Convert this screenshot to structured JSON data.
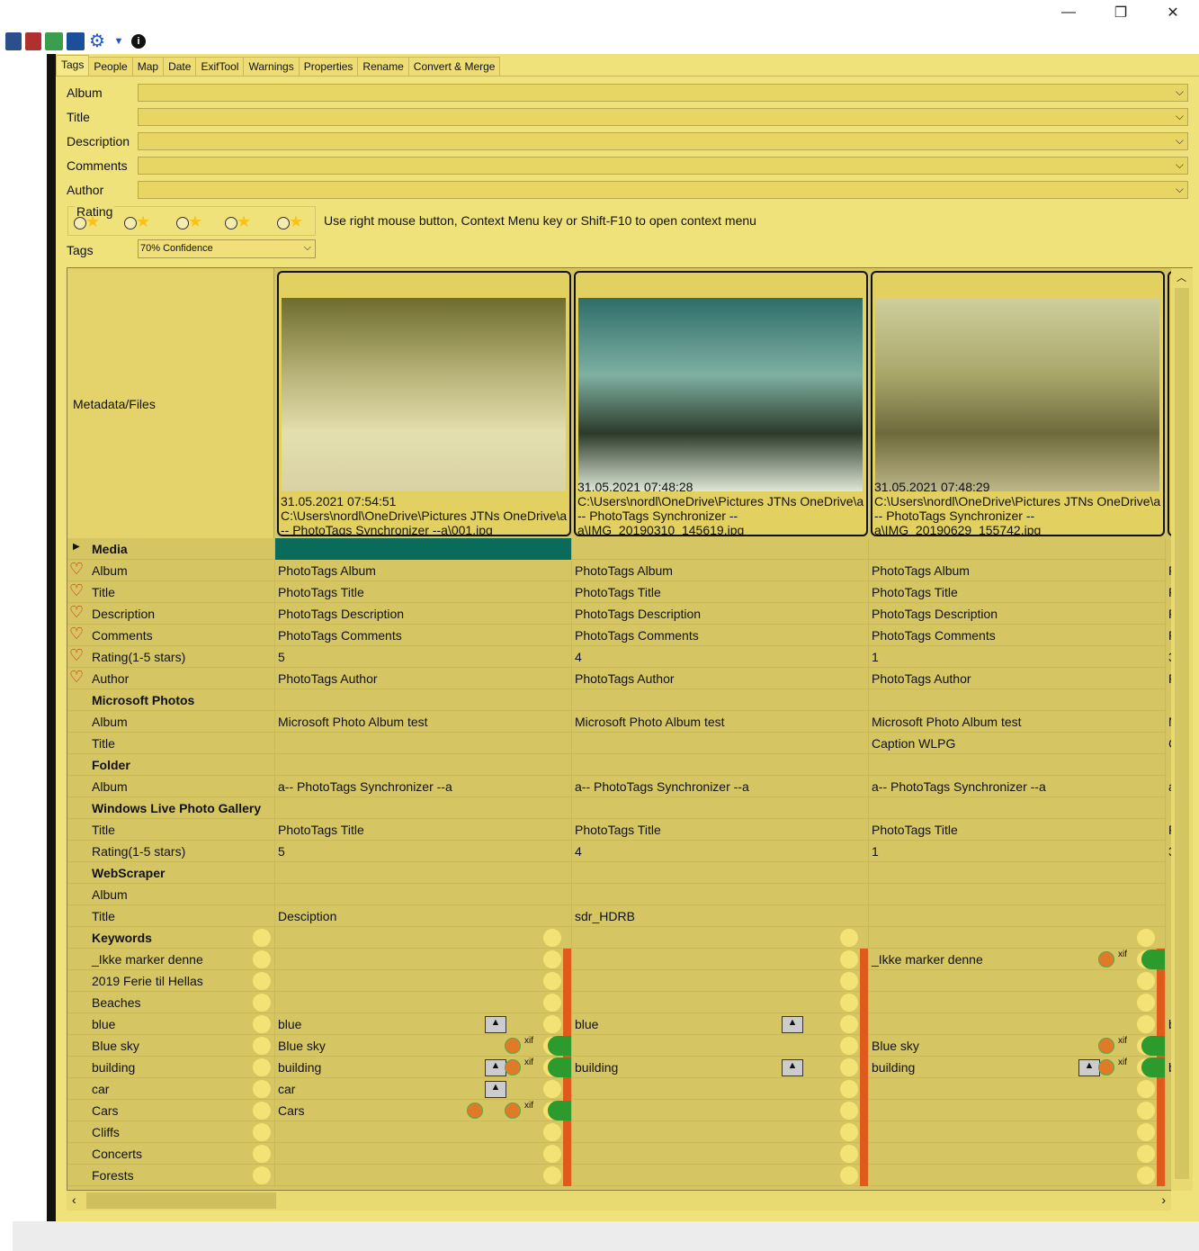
{
  "window": {
    "minimize": "—",
    "maximize": "❐",
    "close": "✕"
  },
  "toolbar": {
    "icons": [
      "panel-left-icon",
      "panel-split-icon",
      "map-icon",
      "save-icon",
      "gear-icon",
      "html-icon",
      "info-icon"
    ]
  },
  "tabs": [
    "Tags",
    "People",
    "Map",
    "Date",
    "ExifTool",
    "Warnings",
    "Properties",
    "Rename",
    "Convert & Merge"
  ],
  "form": {
    "album_label": "Album",
    "title_label": "Title",
    "description_label": "Description",
    "comments_label": "Comments",
    "author_label": "Author",
    "rating_label": "Rating",
    "hint": "Use right mouse button, Context Menu key or Shift-F10 to open context menu",
    "tags_label": "Tags",
    "confidence": "70% Confidence"
  },
  "grid": {
    "header_label": "Metadata/Files",
    "files": [
      {
        "date": "31.05.2021 07:54:51",
        "path1": "C:\\Users\\nordl\\OneDrive\\Pictures JTNs OneDrive\\a",
        "path2": "-- PhotoTags Synchronizer --a\\001.jpg",
        "path3": ""
      },
      {
        "date": "31.05.2021 07:48:28",
        "path1": "C:\\Users\\nordl\\OneDrive\\Pictures JTNs OneDrive\\a",
        "path2": "-- PhotoTags Synchronizer --",
        "path3": "a\\IMG_20190310_145619.jpg"
      },
      {
        "date": "31.05.2021 07:48:29",
        "path1": "C:\\Users\\nordl\\OneDrive\\Pictures JTNs OneDrive\\a",
        "path2": "-- PhotoTags Synchronizer --",
        "path3": "a\\IMG_20190629_155742.jpg"
      }
    ],
    "rows": [
      {
        "label": "Media",
        "bold": true,
        "arrow": true,
        "c": [
          "",
          "",
          ""
        ],
        "extra": ""
      },
      {
        "label": "Album",
        "heart": true,
        "c": [
          "PhotoTags Album",
          "PhotoTags Album",
          "PhotoTags Album"
        ],
        "extra": "P"
      },
      {
        "label": "Title",
        "heart": true,
        "c": [
          "PhotoTags Title",
          "PhotoTags Title",
          "PhotoTags Title"
        ],
        "extra": "P"
      },
      {
        "label": "Description",
        "heart": true,
        "c": [
          "PhotoTags Description",
          "PhotoTags Description",
          "PhotoTags Description"
        ],
        "extra": "P"
      },
      {
        "label": "Comments",
        "heart": true,
        "c": [
          "PhotoTags Comments",
          "PhotoTags Comments",
          "PhotoTags Comments"
        ],
        "extra": "P"
      },
      {
        "label": "Rating(1-5 stars)",
        "heart": true,
        "c": [
          "5",
          "4",
          "1"
        ],
        "extra": "3"
      },
      {
        "label": "Author",
        "heart": true,
        "c": [
          "PhotoTags Author",
          "PhotoTags Author",
          "PhotoTags Author"
        ],
        "extra": "P"
      },
      {
        "label": "Microsoft Photos",
        "bold": true,
        "c": [
          "",
          "",
          ""
        ],
        "extra": ""
      },
      {
        "label": "Album",
        "c": [
          "Microsoft Photo Album test",
          "Microsoft Photo Album test",
          "Microsoft Photo Album test"
        ],
        "extra": "M"
      },
      {
        "label": "Title",
        "c": [
          "",
          "",
          "Caption WLPG"
        ],
        "extra": "C"
      },
      {
        "label": "Folder",
        "bold": true,
        "c": [
          "",
          "",
          ""
        ],
        "extra": ""
      },
      {
        "label": "Album",
        "c": [
          "a-- PhotoTags Synchronizer --a",
          "a-- PhotoTags Synchronizer --a",
          "a-- PhotoTags Synchronizer --a"
        ],
        "extra": "a"
      },
      {
        "label": "Windows Live Photo Gallery",
        "bold": true,
        "c": [
          "",
          "",
          ""
        ],
        "extra": ""
      },
      {
        "label": "Title",
        "c": [
          "PhotoTags Title",
          "PhotoTags Title",
          "PhotoTags Title"
        ],
        "extra": "P"
      },
      {
        "label": "Rating(1-5 stars)",
        "c": [
          "5",
          "4",
          "1"
        ],
        "extra": "3"
      },
      {
        "label": "WebScraper",
        "bold": true,
        "c": [
          "",
          "",
          ""
        ],
        "extra": ""
      },
      {
        "label": "Album",
        "c": [
          "",
          "",
          ""
        ],
        "extra": ""
      },
      {
        "label": "Title",
        "c": [
          "Desciption",
          "sdr_HDRB",
          ""
        ],
        "extra": ""
      },
      {
        "label": "Keywords",
        "bold": true,
        "kw": true,
        "c": [
          "",
          "",
          ""
        ],
        "extra": ""
      },
      {
        "label": "_Ikke marker denne",
        "kw": true,
        "c": [
          "",
          "",
          "_Ikke marker denne"
        ],
        "extra": ""
      },
      {
        "label": "2019 Ferie til Hellas",
        "kw": true,
        "c": [
          "",
          "",
          ""
        ],
        "extra": ""
      },
      {
        "label": "Beaches",
        "kw": true,
        "c": [
          "",
          "",
          ""
        ],
        "extra": ""
      },
      {
        "label": "blue",
        "kw": true,
        "c": [
          "blue",
          "blue",
          ""
        ],
        "extra": "b"
      },
      {
        "label": "Blue sky",
        "kw": true,
        "c": [
          "Blue sky",
          "",
          "Blue sky"
        ],
        "extra": ""
      },
      {
        "label": "building",
        "kw": true,
        "c": [
          "building",
          "building",
          "building"
        ],
        "extra": "b"
      },
      {
        "label": "car",
        "kw": true,
        "c": [
          "car",
          "",
          ""
        ],
        "extra": ""
      },
      {
        "label": "Cars",
        "kw": true,
        "c": [
          "Cars",
          "",
          ""
        ],
        "extra": ""
      },
      {
        "label": "Cliffs",
        "kw": true,
        "c": [
          "",
          "",
          ""
        ],
        "extra": ""
      },
      {
        "label": "Concerts",
        "kw": true,
        "c": [
          "",
          "",
          ""
        ],
        "extra": ""
      },
      {
        "label": "Forests",
        "kw": true,
        "c": [
          "",
          "",
          ""
        ],
        "extra": ""
      }
    ]
  },
  "colors": {
    "background": "#f0e27a",
    "selected_cell": "#0b6b5a",
    "heart": "#dd1111",
    "exif_green": "#2c9a2c"
  }
}
